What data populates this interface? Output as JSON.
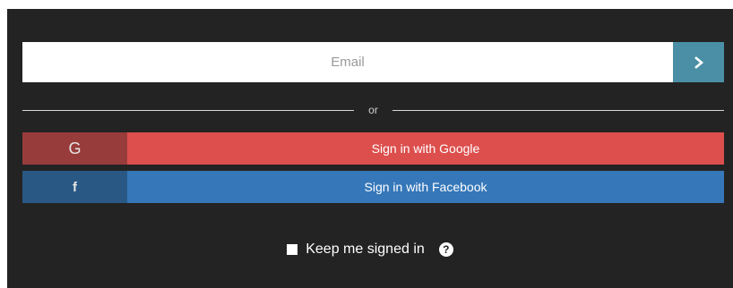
{
  "email": {
    "placeholder": "Email",
    "value": "",
    "submit_icon": "chevron-right-icon"
  },
  "divider": {
    "text": "or"
  },
  "google": {
    "icon_text": "G",
    "label": "Sign in with Google"
  },
  "facebook": {
    "icon_text": "f",
    "label": "Sign in with Facebook"
  },
  "keep_signed_in": {
    "label": "Keep me signed in",
    "checked": false,
    "help_icon_text": "?"
  },
  "colors": {
    "panel_bg": "#232323",
    "submit_bg": "#4a8fa6",
    "google_dark": "#983c3b",
    "google": "#dc4f4d",
    "facebook_dark": "#295885",
    "facebook": "#3577b9"
  }
}
